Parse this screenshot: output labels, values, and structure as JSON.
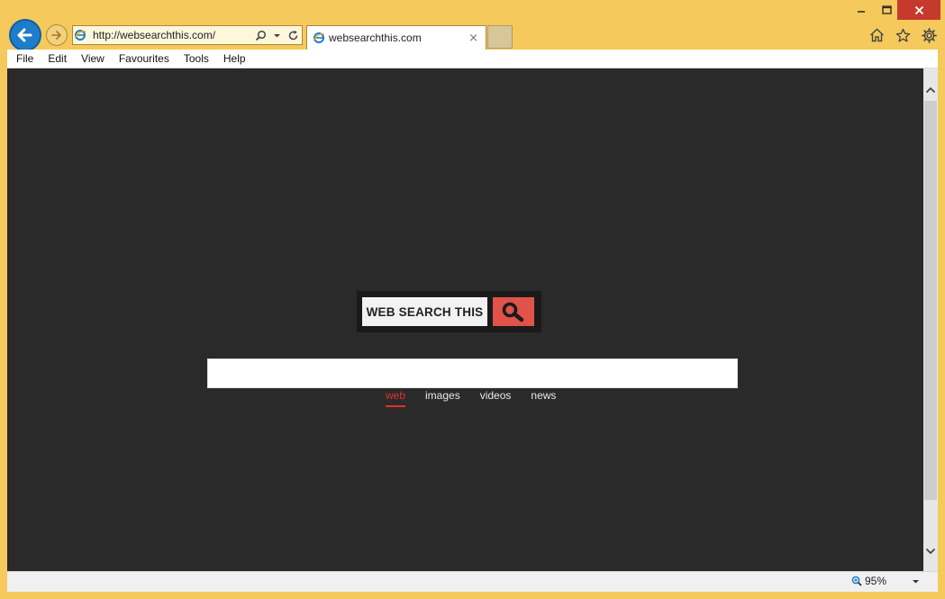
{
  "browser": {
    "address_url": "http://websearchthis.com/",
    "tab_title": "websearchthis.com",
    "tab_close": "×",
    "colors": {
      "frame": "#f6c95d",
      "back_button": "#1e7cc9",
      "close_button": "#c63a2e"
    }
  },
  "menubar": {
    "items": [
      {
        "label": "File"
      },
      {
        "label": "Edit"
      },
      {
        "label": "View"
      },
      {
        "label": "Favourites"
      },
      {
        "label": "Tools"
      },
      {
        "label": "Help"
      }
    ]
  },
  "page": {
    "logo_text": "WEB SEARCH THIS",
    "search_placeholder": "",
    "search_value": "",
    "search_tabs": [
      {
        "label": "web",
        "active": true
      },
      {
        "label": "images",
        "active": false
      },
      {
        "label": "videos",
        "active": false
      },
      {
        "label": "news",
        "active": false
      }
    ],
    "colors": {
      "background": "#2a2a2a",
      "logo_accent": "#e0524a",
      "active_tab": "#e0302a"
    }
  },
  "statusbar": {
    "zoom": "95%"
  }
}
